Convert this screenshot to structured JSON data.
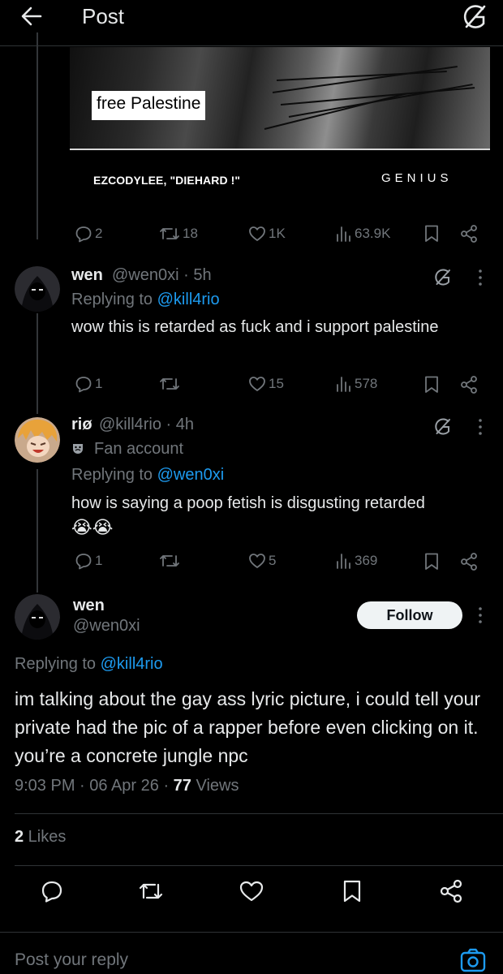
{
  "header": {
    "title": "Post"
  },
  "lyric_card": {
    "lyric": "free Palestine",
    "credit": "EZCODYLEE, \"DIEHARD !\"",
    "brand": "GENIUS"
  },
  "original_post_actions": {
    "replies": "2",
    "reposts": "18",
    "likes": "1K",
    "views": "63.9K"
  },
  "reply1": {
    "name": "wen",
    "handle": "@wen0xi",
    "time": " · 5h",
    "replying_prefix": "Replying to ",
    "replying_to": "@kill4rio",
    "text": "wow this is retarded as fuck and i support palestine",
    "replies": "1",
    "reposts": "",
    "likes": "15",
    "views": "578"
  },
  "reply2": {
    "name": "riø",
    "handle": "@kill4rio",
    "time": " · 4h",
    "badge": "Fan account",
    "replying_prefix": "Replying to ",
    "replying_to": "@wen0xi",
    "text": "how is saying a poop fetish is disgusting retarded",
    "emoji": "😭😭",
    "replies": "1",
    "reposts": "",
    "likes": "5",
    "views": "369"
  },
  "focused_post": {
    "name": "wen",
    "handle": "@wen0xi",
    "follow_label": "Follow",
    "replying_prefix": "Replying to ",
    "replying_to": "@kill4rio",
    "text": "im talking about the gay ass lyric picture, i could tell your private had the pic of a rapper before even clicking on it. you’re a concrete jungle npc",
    "time": "9:03 PM",
    "date": "06 Apr 26",
    "views_count": "77",
    "views_label": " Views",
    "likes_count": "2",
    "likes_label": " Likes"
  },
  "composer": {
    "placeholder": "Post your reply"
  },
  "colors": {
    "background": "#000000",
    "text": "#e7e9ea",
    "muted": "#71767b",
    "link": "#1d9bf0",
    "divider": "#2f3336"
  }
}
